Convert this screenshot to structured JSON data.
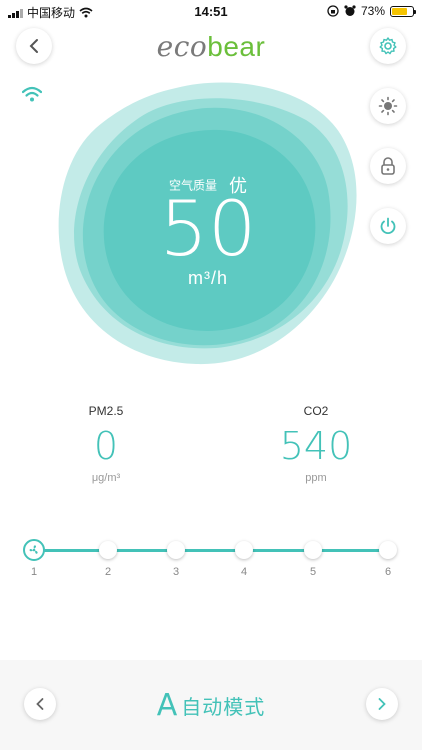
{
  "status_bar": {
    "carrier": "中国移动",
    "time": "14:51",
    "battery": "73%",
    "battery_level": 0.73
  },
  "header": {
    "logo_part1": "eco",
    "logo_part2": "bear",
    "icons": [
      "back-icon",
      "settings-gear-icon"
    ]
  },
  "side_controls": [
    "brightness-icon",
    "lock-icon",
    "power-icon"
  ],
  "air": {
    "quality_label": "空气质量",
    "quality_value": "优",
    "flow_value": "50",
    "flow_unit": "m³/h"
  },
  "readings": [
    {
      "label": "PM2.5",
      "value": "0",
      "unit": "μg/m³"
    },
    {
      "label": "CO2",
      "value": "540",
      "unit": "ppm"
    }
  ],
  "fan_speed": {
    "levels": [
      "1",
      "2",
      "3",
      "4",
      "5",
      "6"
    ],
    "selected": "1"
  },
  "mode": {
    "icon_glyph": "A",
    "label": "自动模式"
  },
  "colors": {
    "accent": "#43c2b8",
    "logo_green": "#6bbf3b"
  }
}
